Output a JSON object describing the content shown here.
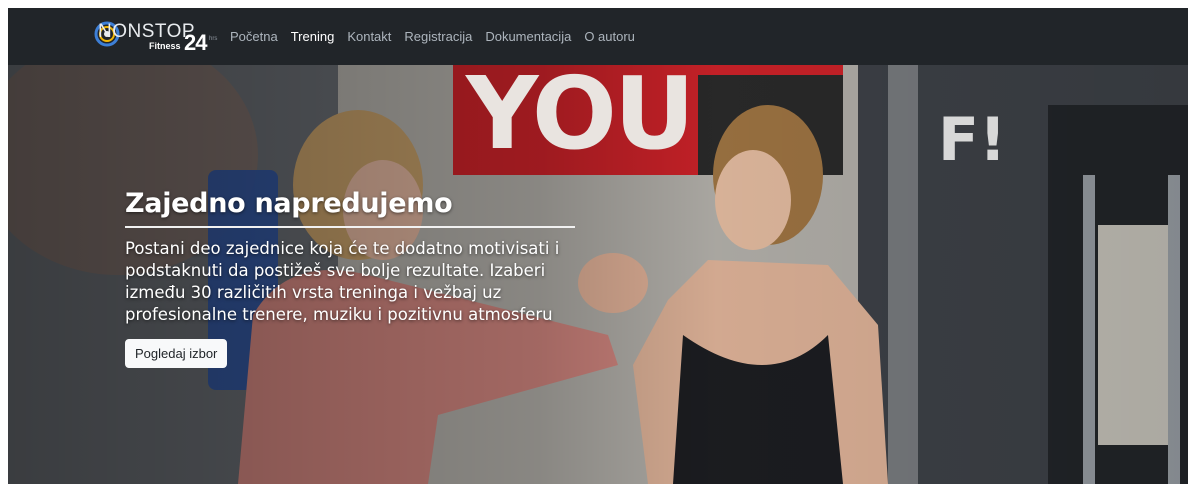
{
  "navbar": {
    "logo": {
      "brand_text": "NONSTOP",
      "sub_text": "Fitness",
      "number_text": "24",
      "hours_text": "hrs"
    },
    "links": [
      {
        "label": "Početna",
        "active": false
      },
      {
        "label": "Trening",
        "active": true
      },
      {
        "label": "Kontakt",
        "active": false
      },
      {
        "label": "Registracija",
        "active": false
      },
      {
        "label": "Dokumentacija",
        "active": false
      },
      {
        "label": "O autoru",
        "active": false
      }
    ]
  },
  "hero": {
    "background_sign_text": "YOU",
    "background_sign_trailing": "F!",
    "title": "Zajedno napredujemo",
    "description": "Postani deo zajednice koja će te dodatno motivisati i podstaknuti da postižeš sve bolje rezultate. Izaberi između 30 različitih vrsta treninga i vežbaj uz profesionalne trenere, muziku i pozitivnu atmosferu",
    "button_label": "Pogledaj izbor"
  },
  "colors": {
    "navbar_bg": "#212529",
    "nav_link": "#adb5bd",
    "nav_link_active": "#ffffff",
    "sign_red": "#d2232a",
    "button_bg": "#f8f9fa"
  }
}
